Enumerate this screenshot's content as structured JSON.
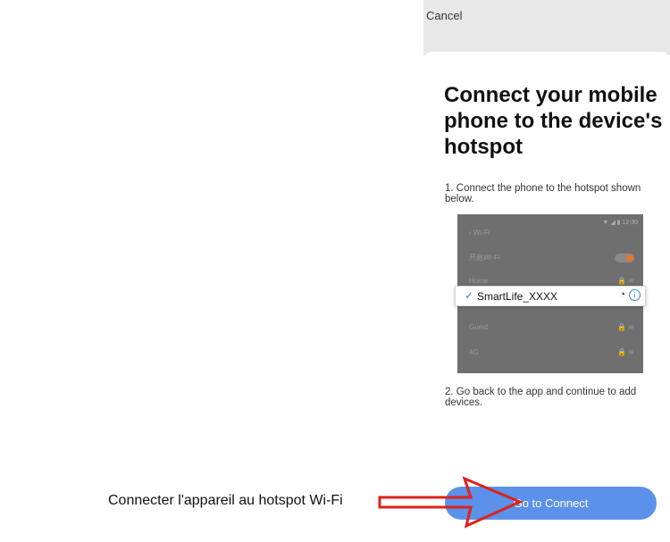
{
  "app": {
    "cancel_label": "Cancel",
    "title": "Connect your mobile phone to the device's hotspot",
    "step1": "1. Connect the phone to the hotspot shown below.",
    "step2": "2. Go back to the app and continue to add devices.",
    "button_label": "Go to Connect"
  },
  "illustration": {
    "status_time": "12:30",
    "wifi_header": "‹ Wi-Fi",
    "enable_wifi_label": "开启Wi-Fi",
    "networks": [
      "Home",
      "Guest",
      "4G"
    ],
    "selected_network": "SmartLife_XXXX"
  },
  "annotation": {
    "caption": "Connecter l'appareil au hotspot Wi-Fi",
    "arrow_color": "#e0201a"
  },
  "colors": {
    "accent": "#5b91ea",
    "toggle_on": "#e8732a"
  }
}
